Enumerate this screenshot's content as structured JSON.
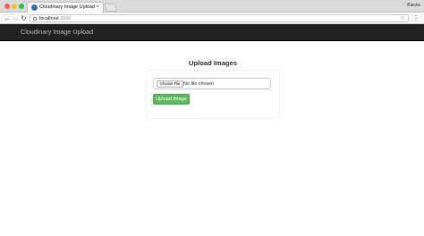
{
  "browser": {
    "tab_title": "Cloudinary Image Upload",
    "tab_close": "×",
    "profile_name": "Blacks",
    "url_host": "localhost",
    "url_port": ":3000",
    "nav_back": "←",
    "nav_forward": "→",
    "nav_reload": "↻",
    "star": "☆",
    "menu": "⋮"
  },
  "navbar": {
    "brand": "Cloudinary Image Upload",
    "background": "#222222"
  },
  "upload_form": {
    "heading": "Upload Images",
    "choose_file_label": "Choose File",
    "file_status": "No file chosen",
    "submit_label": "Upload Image",
    "submit_color": "#5cb85c"
  }
}
